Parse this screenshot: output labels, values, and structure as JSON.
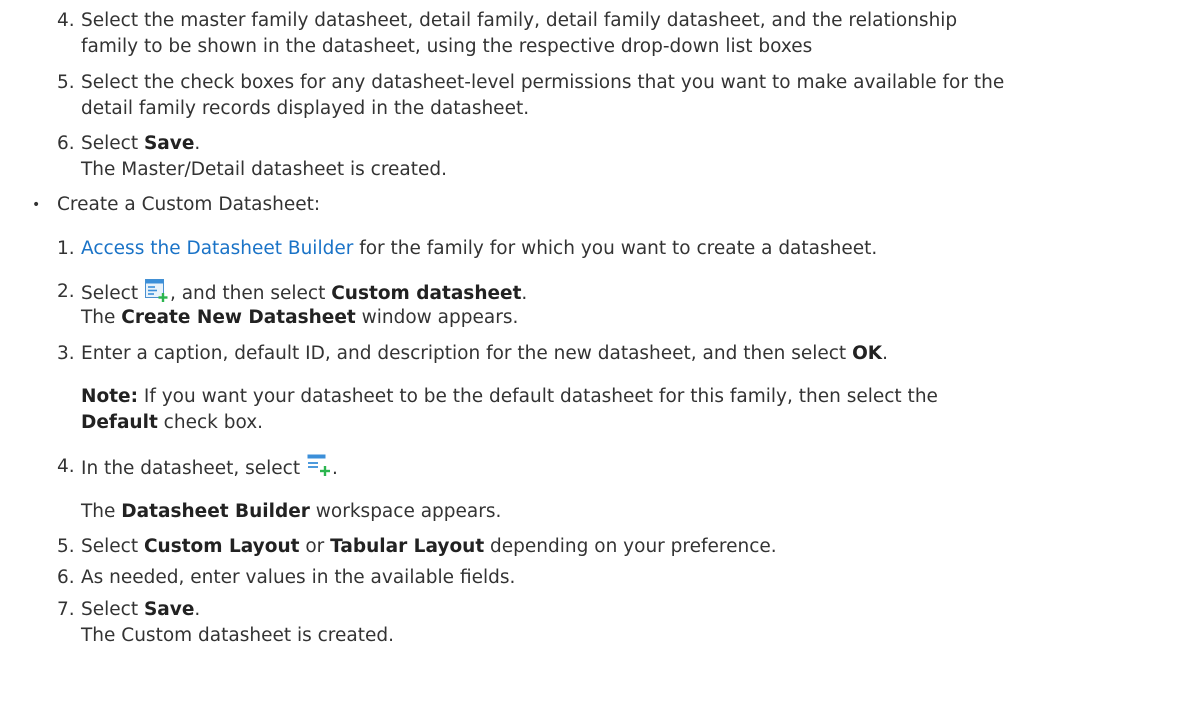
{
  "master": {
    "step4": {
      "num": "4.",
      "line1": "Select the master family datasheet, detail family, detail family datasheet, and the relationship",
      "line2": "family to be shown in the datasheet, using the respective drop-down list boxes"
    },
    "step5": {
      "num": "5.",
      "line1": "Select the check boxes for any datasheet-level permissions that you want to make available for the",
      "line2": "detail family records displayed in the datasheet."
    },
    "step6": {
      "num": "6.",
      "pre": "Select ",
      "bold": "Save",
      "post": ".",
      "result": "The Master/Detail datasheet is created."
    }
  },
  "custom": {
    "bullet_symbol": "•",
    "heading": "Create a Custom Datasheet:",
    "step1": {
      "num": "1.",
      "link": "Access the Datasheet Builder",
      "rest": " for the family for which you want to create a datasheet."
    },
    "step2": {
      "num": "2.",
      "pre": "Select ",
      "mid": ", and then select ",
      "bold": "Custom datasheet",
      "post": ".",
      "result_pre": "The ",
      "result_bold": "Create New Datasheet",
      "result_post": " window appears.",
      "icon": "new-datasheet-icon"
    },
    "step3": {
      "num": "3.",
      "pre": "Enter a caption, default ID, and description for the new datasheet, and then select ",
      "bold": "OK",
      "post": "."
    },
    "note": {
      "label": "Note:",
      "line1": " If you want your datasheet to be the default datasheet for this family, then select the",
      "bold2": "Default",
      "line2": " check box."
    },
    "step4": {
      "num": "4.",
      "pre": "In the datasheet, select ",
      "post": ".",
      "result_pre": "The ",
      "result_bold": "Datasheet Builder",
      "result_post": " workspace appears.",
      "icon": "add-section-icon"
    },
    "step5": {
      "num": "5.",
      "pre": "Select ",
      "bold1": "Custom Layout",
      "mid": " or ",
      "bold2": "Tabular Layout",
      "post": " depending on your preference."
    },
    "step6": {
      "num": "6.",
      "text": "As needed, enter values in the available fields."
    },
    "step7": {
      "num": "7.",
      "pre": "Select ",
      "bold": "Save",
      "post": ".",
      "result": "The Custom datasheet is created."
    }
  }
}
